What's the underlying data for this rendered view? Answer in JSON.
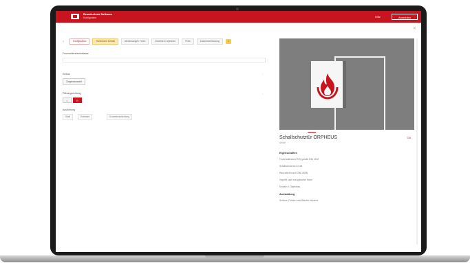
{
  "header": {
    "company": "Brandschutz Software",
    "company_sub": "Konfigurator",
    "link": "Hilfe",
    "button": "Anmelden"
  },
  "tabs": [
    {
      "label": "Konfiguration"
    },
    {
      "label": "Technische Details"
    },
    {
      "label": "Abmessungen Türen"
    },
    {
      "label": "Zubehör & Optionen"
    },
    {
      "label": "Preis"
    },
    {
      "label": "Zusammenfassung"
    }
  ],
  "tab_badge": "1",
  "form": {
    "title": "Feuerwiderstandsklasse",
    "group1_label": "Einbau",
    "group1_button": "Zargenauswahl",
    "group2_label": "Öffnungsrichtung",
    "toggle_off": "L",
    "toggle_on": "R",
    "group3_label": "Ausführung",
    "chips": [
      "Stahl",
      "Edelstahl",
      "Sonderbeschichtung"
    ]
  },
  "product": {
    "title": "Schallschutztür ORPHEUS",
    "subtitle": "Artikel",
    "code": "T30",
    "section1": "Eigenschaften",
    "features": [
      "Feuerwiderstand T30 gemäß DIN 4102",
      "Schallschutz bis 42 dB",
      "Rauchdicht nach DIN 18095",
      "Geprüft nach europäischer Norm",
      "Einsatz in Objektbau"
    ],
    "section2": "Ausstattung",
    "equipment": "Schloss, Drücker und Bänder inklusive"
  },
  "colors": {
    "brand": "#c8141e",
    "image_background": "#7e7e7e"
  }
}
